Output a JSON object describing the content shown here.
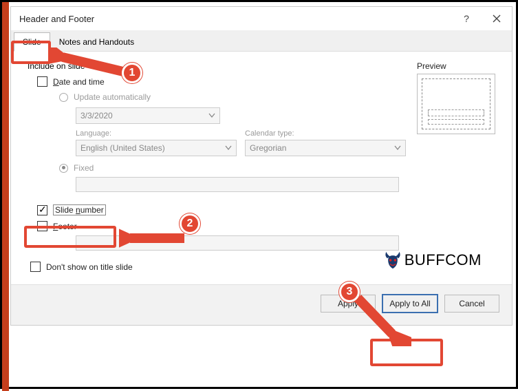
{
  "dialog": {
    "title": "Header and Footer",
    "tabs": {
      "slide": "Slide",
      "notes": "Notes and Handouts"
    },
    "group_label": "Include on slide",
    "date_time": {
      "label": "Date and time",
      "update_auto": "Update automatically",
      "date_value": "3/3/2020",
      "language_label": "Language:",
      "language_value": "English (United States)",
      "calendar_label": "Calendar type:",
      "calendar_value": "Gregorian",
      "fixed": "Fixed"
    },
    "slide_number": "Slide number",
    "footer": "Footer",
    "dont_show": "Don't show on title slide",
    "preview_label": "Preview",
    "buttons": {
      "apply": "Apply",
      "apply_all": "Apply to All",
      "cancel": "Cancel"
    }
  },
  "callouts": {
    "one": "1",
    "two": "2",
    "three": "3"
  },
  "watermark": "BUFFCOM"
}
